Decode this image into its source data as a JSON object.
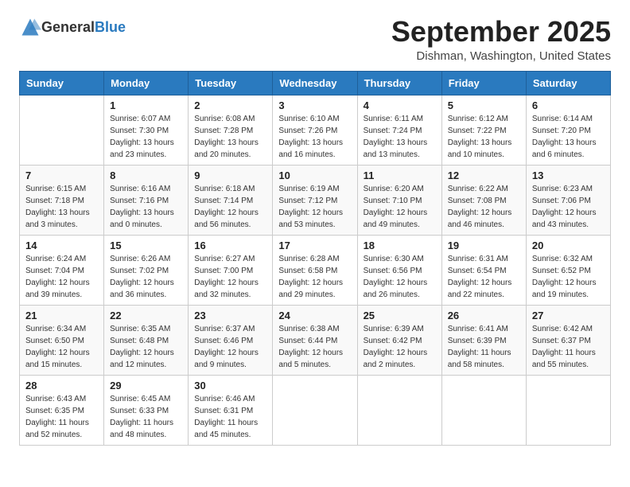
{
  "header": {
    "logo_general": "General",
    "logo_blue": "Blue",
    "title": "September 2025",
    "subtitle": "Dishman, Washington, United States"
  },
  "weekdays": [
    "Sunday",
    "Monday",
    "Tuesday",
    "Wednesday",
    "Thursday",
    "Friday",
    "Saturday"
  ],
  "weeks": [
    [
      {
        "day": "",
        "sunrise": "",
        "sunset": "",
        "daylight": ""
      },
      {
        "day": "1",
        "sunrise": "Sunrise: 6:07 AM",
        "sunset": "Sunset: 7:30 PM",
        "daylight": "Daylight: 13 hours and 23 minutes."
      },
      {
        "day": "2",
        "sunrise": "Sunrise: 6:08 AM",
        "sunset": "Sunset: 7:28 PM",
        "daylight": "Daylight: 13 hours and 20 minutes."
      },
      {
        "day": "3",
        "sunrise": "Sunrise: 6:10 AM",
        "sunset": "Sunset: 7:26 PM",
        "daylight": "Daylight: 13 hours and 16 minutes."
      },
      {
        "day": "4",
        "sunrise": "Sunrise: 6:11 AM",
        "sunset": "Sunset: 7:24 PM",
        "daylight": "Daylight: 13 hours and 13 minutes."
      },
      {
        "day": "5",
        "sunrise": "Sunrise: 6:12 AM",
        "sunset": "Sunset: 7:22 PM",
        "daylight": "Daylight: 13 hours and 10 minutes."
      },
      {
        "day": "6",
        "sunrise": "Sunrise: 6:14 AM",
        "sunset": "Sunset: 7:20 PM",
        "daylight": "Daylight: 13 hours and 6 minutes."
      }
    ],
    [
      {
        "day": "7",
        "sunrise": "Sunrise: 6:15 AM",
        "sunset": "Sunset: 7:18 PM",
        "daylight": "Daylight: 13 hours and 3 minutes."
      },
      {
        "day": "8",
        "sunrise": "Sunrise: 6:16 AM",
        "sunset": "Sunset: 7:16 PM",
        "daylight": "Daylight: 13 hours and 0 minutes."
      },
      {
        "day": "9",
        "sunrise": "Sunrise: 6:18 AM",
        "sunset": "Sunset: 7:14 PM",
        "daylight": "Daylight: 12 hours and 56 minutes."
      },
      {
        "day": "10",
        "sunrise": "Sunrise: 6:19 AM",
        "sunset": "Sunset: 7:12 PM",
        "daylight": "Daylight: 12 hours and 53 minutes."
      },
      {
        "day": "11",
        "sunrise": "Sunrise: 6:20 AM",
        "sunset": "Sunset: 7:10 PM",
        "daylight": "Daylight: 12 hours and 49 minutes."
      },
      {
        "day": "12",
        "sunrise": "Sunrise: 6:22 AM",
        "sunset": "Sunset: 7:08 PM",
        "daylight": "Daylight: 12 hours and 46 minutes."
      },
      {
        "day": "13",
        "sunrise": "Sunrise: 6:23 AM",
        "sunset": "Sunset: 7:06 PM",
        "daylight": "Daylight: 12 hours and 43 minutes."
      }
    ],
    [
      {
        "day": "14",
        "sunrise": "Sunrise: 6:24 AM",
        "sunset": "Sunset: 7:04 PM",
        "daylight": "Daylight: 12 hours and 39 minutes."
      },
      {
        "day": "15",
        "sunrise": "Sunrise: 6:26 AM",
        "sunset": "Sunset: 7:02 PM",
        "daylight": "Daylight: 12 hours and 36 minutes."
      },
      {
        "day": "16",
        "sunrise": "Sunrise: 6:27 AM",
        "sunset": "Sunset: 7:00 PM",
        "daylight": "Daylight: 12 hours and 32 minutes."
      },
      {
        "day": "17",
        "sunrise": "Sunrise: 6:28 AM",
        "sunset": "Sunset: 6:58 PM",
        "daylight": "Daylight: 12 hours and 29 minutes."
      },
      {
        "day": "18",
        "sunrise": "Sunrise: 6:30 AM",
        "sunset": "Sunset: 6:56 PM",
        "daylight": "Daylight: 12 hours and 26 minutes."
      },
      {
        "day": "19",
        "sunrise": "Sunrise: 6:31 AM",
        "sunset": "Sunset: 6:54 PM",
        "daylight": "Daylight: 12 hours and 22 minutes."
      },
      {
        "day": "20",
        "sunrise": "Sunrise: 6:32 AM",
        "sunset": "Sunset: 6:52 PM",
        "daylight": "Daylight: 12 hours and 19 minutes."
      }
    ],
    [
      {
        "day": "21",
        "sunrise": "Sunrise: 6:34 AM",
        "sunset": "Sunset: 6:50 PM",
        "daylight": "Daylight: 12 hours and 15 minutes."
      },
      {
        "day": "22",
        "sunrise": "Sunrise: 6:35 AM",
        "sunset": "Sunset: 6:48 PM",
        "daylight": "Daylight: 12 hours and 12 minutes."
      },
      {
        "day": "23",
        "sunrise": "Sunrise: 6:37 AM",
        "sunset": "Sunset: 6:46 PM",
        "daylight": "Daylight: 12 hours and 9 minutes."
      },
      {
        "day": "24",
        "sunrise": "Sunrise: 6:38 AM",
        "sunset": "Sunset: 6:44 PM",
        "daylight": "Daylight: 12 hours and 5 minutes."
      },
      {
        "day": "25",
        "sunrise": "Sunrise: 6:39 AM",
        "sunset": "Sunset: 6:42 PM",
        "daylight": "Daylight: 12 hours and 2 minutes."
      },
      {
        "day": "26",
        "sunrise": "Sunrise: 6:41 AM",
        "sunset": "Sunset: 6:39 PM",
        "daylight": "Daylight: 11 hours and 58 minutes."
      },
      {
        "day": "27",
        "sunrise": "Sunrise: 6:42 AM",
        "sunset": "Sunset: 6:37 PM",
        "daylight": "Daylight: 11 hours and 55 minutes."
      }
    ],
    [
      {
        "day": "28",
        "sunrise": "Sunrise: 6:43 AM",
        "sunset": "Sunset: 6:35 PM",
        "daylight": "Daylight: 11 hours and 52 minutes."
      },
      {
        "day": "29",
        "sunrise": "Sunrise: 6:45 AM",
        "sunset": "Sunset: 6:33 PM",
        "daylight": "Daylight: 11 hours and 48 minutes."
      },
      {
        "day": "30",
        "sunrise": "Sunrise: 6:46 AM",
        "sunset": "Sunset: 6:31 PM",
        "daylight": "Daylight: 11 hours and 45 minutes."
      },
      {
        "day": "",
        "sunrise": "",
        "sunset": "",
        "daylight": ""
      },
      {
        "day": "",
        "sunrise": "",
        "sunset": "",
        "daylight": ""
      },
      {
        "day": "",
        "sunrise": "",
        "sunset": "",
        "daylight": ""
      },
      {
        "day": "",
        "sunrise": "",
        "sunset": "",
        "daylight": ""
      }
    ]
  ]
}
